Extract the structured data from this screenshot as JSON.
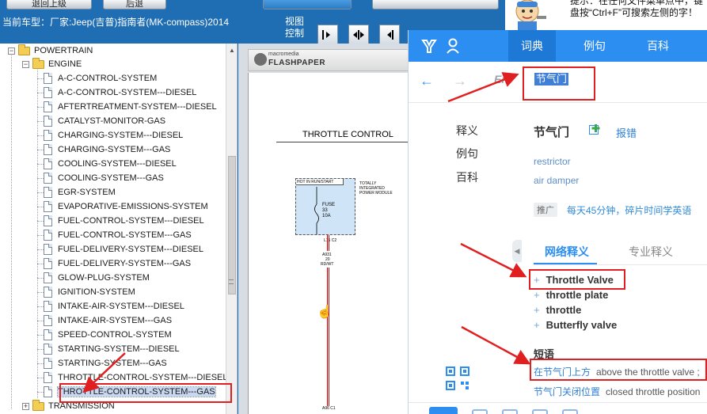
{
  "toolbar": {
    "buttons": [
      {
        "label": "退回上级",
        "style": "grey"
      },
      {
        "label": "后退",
        "style": "grey"
      },
      {
        "label": "",
        "style": "blue"
      },
      {
        "label": "",
        "style": "grey"
      }
    ],
    "vehicle_label": "当前车型：厂家:Jeep(吉普)指南者(MK-compass)2014",
    "view_control_label": "视图控制",
    "view_buttons": [
      {
        "icon": "fit-width-icon"
      },
      {
        "icon": "fit-page-icon"
      },
      {
        "icon": "prev-page-icon"
      }
    ]
  },
  "tip": {
    "text": "提示：在任何文件菜单点中，键盘按“Ctrl+F”可搜索左侧的字！"
  },
  "tree": {
    "items": [
      {
        "label": "POWERTRAIN",
        "type": "folder",
        "level": 0,
        "expanded": true
      },
      {
        "label": "ENGINE",
        "type": "folder",
        "level": 1,
        "expanded": true
      },
      {
        "label": "A-C-CONTROL-SYSTEM",
        "type": "doc",
        "level": 2
      },
      {
        "label": "A-C-CONTROL-SYSTEM---DIESEL",
        "type": "doc",
        "level": 2
      },
      {
        "label": "AFTERTREATMENT-SYSTEM---DIESEL",
        "type": "doc",
        "level": 2
      },
      {
        "label": "CATALYST-MONITOR-GAS",
        "type": "doc",
        "level": 2
      },
      {
        "label": "CHARGING-SYSTEM---DIESEL",
        "type": "doc",
        "level": 2
      },
      {
        "label": "CHARGING-SYSTEM---GAS",
        "type": "doc",
        "level": 2
      },
      {
        "label": "COOLING-SYSTEM---DIESEL",
        "type": "doc",
        "level": 2
      },
      {
        "label": "COOLING-SYSTEM---GAS",
        "type": "doc",
        "level": 2
      },
      {
        "label": "EGR-SYSTEM",
        "type": "doc",
        "level": 2
      },
      {
        "label": "EVAPORATIVE-EMISSIONS-SYSTEM",
        "type": "doc",
        "level": 2
      },
      {
        "label": "FUEL-CONTROL-SYSTEM---DIESEL",
        "type": "doc",
        "level": 2
      },
      {
        "label": "FUEL-CONTROL-SYSTEM---GAS",
        "type": "doc",
        "level": 2
      },
      {
        "label": "FUEL-DELIVERY-SYSTEM---DIESEL",
        "type": "doc",
        "level": 2
      },
      {
        "label": "FUEL-DELIVERY-SYSTEM---GAS",
        "type": "doc",
        "level": 2
      },
      {
        "label": "GLOW-PLUG-SYSTEM",
        "type": "doc",
        "level": 2
      },
      {
        "label": "IGNITION-SYSTEM",
        "type": "doc",
        "level": 2
      },
      {
        "label": "INTAKE-AIR-SYSTEM---DIESEL",
        "type": "doc",
        "level": 2
      },
      {
        "label": "INTAKE-AIR-SYSTEM---GAS",
        "type": "doc",
        "level": 2
      },
      {
        "label": "SPEED-CONTROL-SYSTEM",
        "type": "doc",
        "level": 2
      },
      {
        "label": "STARTING-SYSTEM---DIESEL",
        "type": "doc",
        "level": 2
      },
      {
        "label": "STARTING-SYSTEM---GAS",
        "type": "doc",
        "level": 2
      },
      {
        "label": "THROTTLE-CONTROL-SYSTEM---DIESEL",
        "type": "doc",
        "level": 2
      },
      {
        "label": "THROTTLE-CONTROL-SYSTEM---GAS",
        "type": "doc",
        "level": 2,
        "selected": true
      },
      {
        "label": "TRANSMISSION",
        "type": "folder",
        "level": 1,
        "expanded": false
      }
    ]
  },
  "flashpaper": {
    "brand_small": "macromedia",
    "brand_big": "FLASHPAPER",
    "schematic": {
      "title": "THROTTLE CONTROL",
      "fuse_header": "HOT IN RUN/START",
      "fuse_text": "FUSE\n33\n10A",
      "module_label": "TOTALLY INTEGRATED POWER MODULE",
      "connector_top": "L15 C2",
      "wire_code": "A931",
      "wire_gauge": "20",
      "wire_color": "RD/WT",
      "connector_bottom": "A96 C1"
    }
  },
  "dictionary": {
    "tabs": [
      "词典",
      "例句",
      "百科"
    ],
    "active_tab": 0,
    "lang_tag": "En",
    "search_value": "节气门",
    "side_menu": [
      "释义",
      "例句",
      "百科"
    ],
    "word": "节气门",
    "report_label": "报错",
    "definitions": [
      "restrictor",
      "air damper"
    ],
    "ad_tag": "推广",
    "ad_text": "每天45分钟，碎片时间学英语",
    "sub_tabs": [
      "网络释义",
      "专业释义"
    ],
    "active_sub_tab": 0,
    "web_meanings": [
      "Throttle Valve",
      "throttle plate",
      "throttle",
      "Butterfly valve"
    ],
    "phrase_header": "短语",
    "phrases": [
      {
        "zh": "在节气门上方",
        "en": "above the throttle valve ;"
      },
      {
        "zh": "节气门关闭位置",
        "en": "closed throttle position"
      }
    ],
    "accent_color": "#2c8ef0"
  },
  "annotations": {
    "color": "#e02020"
  }
}
